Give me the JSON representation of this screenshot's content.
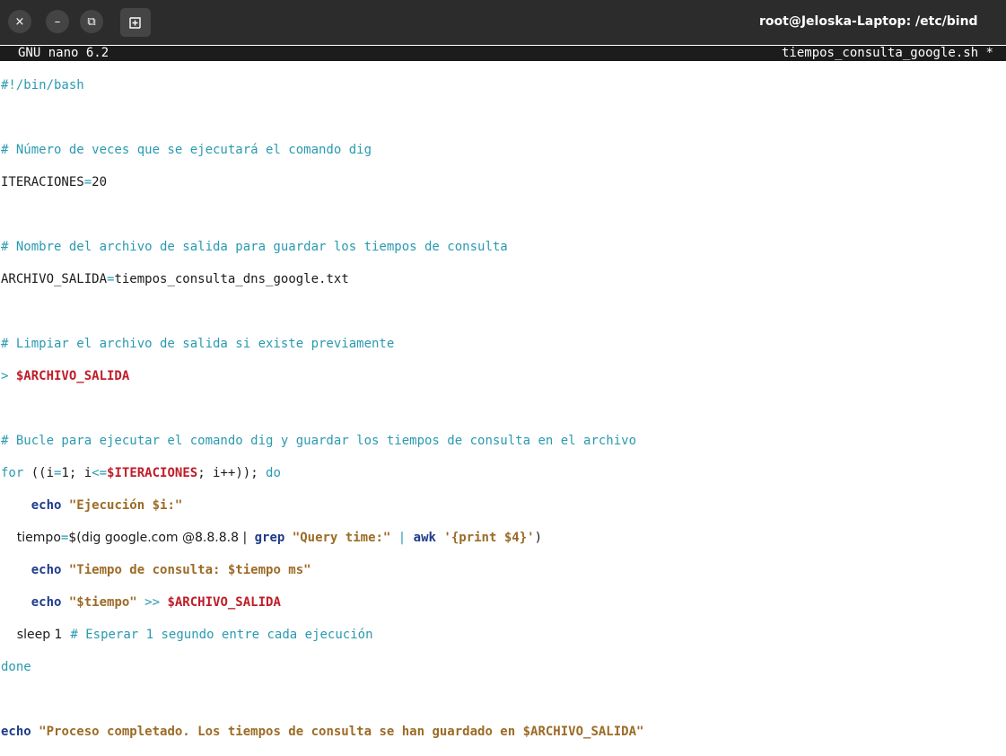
{
  "window": {
    "title": "root@Jeloska-Laptop: /etc/bind",
    "close_icon": "×",
    "minimize_icon": "–",
    "maximize_icon": "⧉",
    "new_tab_icon": "plus-box-icon"
  },
  "nano": {
    "version": "GNU nano 6.2",
    "filename": "tiempos_consulta_google.sh *"
  },
  "code": {
    "l1": "#!/bin/bash",
    "l3": "# Número de veces que se ejecutará el comando dig",
    "l4a": "ITERACIONES",
    "l4b": "=",
    "l4c": "20",
    "l6": "# Nombre del archivo de salida para guardar los tiempos de consulta",
    "l7a": "ARCHIVO_SALIDA",
    "l7b": "=",
    "l7c": "tiempos_consulta_dns_google.txt",
    "l9": "# Limpiar el archivo de salida si existe previamente",
    "l10a": "> ",
    "l10b": "$ARCHIVO_SALIDA",
    "l12": "# Bucle para ejecutar el comando dig y guardar los tiempos de consulta en el archivo",
    "l13a": "for",
    "l13b": " ((i",
    "l13c": "=",
    "l13d": "1; i",
    "l13e": "<=",
    "l13f": "$ITERACIONES",
    "l13g": "; i++)); ",
    "l13h": "do",
    "l14a": "    ",
    "l14b": "echo",
    "l14c": " ",
    "l14d": "\"Ejecución $i:\"",
    "l15a": "    tiempo",
    "l15b": "=",
    "l15c": "$(",
    "l15d": "dig google.com @8.8.8.8 ",
    "l15e": "|",
    "l15f": " ",
    "l15g": "grep",
    "l15h": " ",
    "l15i": "\"Query time:\"",
    "l15j": " ",
    "l15k": "|",
    "l15l": " ",
    "l15m": "awk",
    "l15n": " ",
    "l15o": "'{print $4}'",
    "l15p": ")",
    "l16a": "    ",
    "l16b": "echo",
    "l16c": " ",
    "l16d": "\"Tiempo de consulta: $tiempo ms\"",
    "l17a": "    ",
    "l17b": "echo",
    "l17c": " ",
    "l17d": "\"$tiempo\"",
    "l17e": " >> ",
    "l17f": "$ARCHIVO_SALIDA",
    "l18a": "    sleep 1  ",
    "l18b": "# Esperar 1 segundo entre cada ejecución",
    "l19": "done",
    "l21a": "echo",
    "l21b": " ",
    "l21c": "\"Proceso completado. Los tiempos de consulta se han guardado en $ARCHIVO_SALIDA\""
  }
}
